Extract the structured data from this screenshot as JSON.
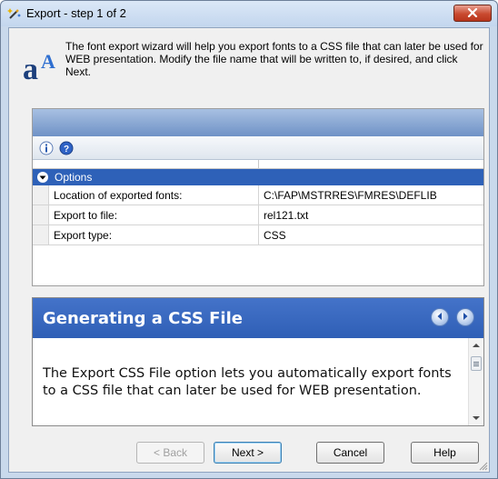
{
  "window": {
    "title": "Export - step 1 of 2",
    "icons": {
      "title": "magic-wand-icon",
      "close": "close-icon"
    }
  },
  "header": {
    "logo_icon": "font-letter-a-icon",
    "description": "The font export wizard will help you export fonts to a CSS file that can later be used for WEB presentation. Modify the file name that will be written to, if desired, and click Next."
  },
  "property_grid": {
    "toolbar": [
      "info-icon",
      "help-icon"
    ],
    "category": "Options",
    "rows": [
      {
        "name": "Location of exported fonts:",
        "value": "C:\\FAP\\MSTRRES\\FMRES\\DEFLIB"
      },
      {
        "name": "Export to file:",
        "value": "rel121.txt"
      },
      {
        "name": "Export type:",
        "value": "CSS"
      }
    ]
  },
  "help_panel": {
    "title": "Generating a CSS File",
    "body": "The Export CSS File option lets you automatically export fonts to a CSS file that can later be used for WEB presentation.",
    "nav": [
      "back-arrow-icon",
      "forward-arrow-icon"
    ]
  },
  "buttons": {
    "back": "< Back",
    "next": "Next >",
    "cancel": "Cancel",
    "help": "Help"
  },
  "colors": {
    "selected_row": "#2e61b8",
    "help_header": "#3565bb",
    "close_button": "#c94a30"
  }
}
